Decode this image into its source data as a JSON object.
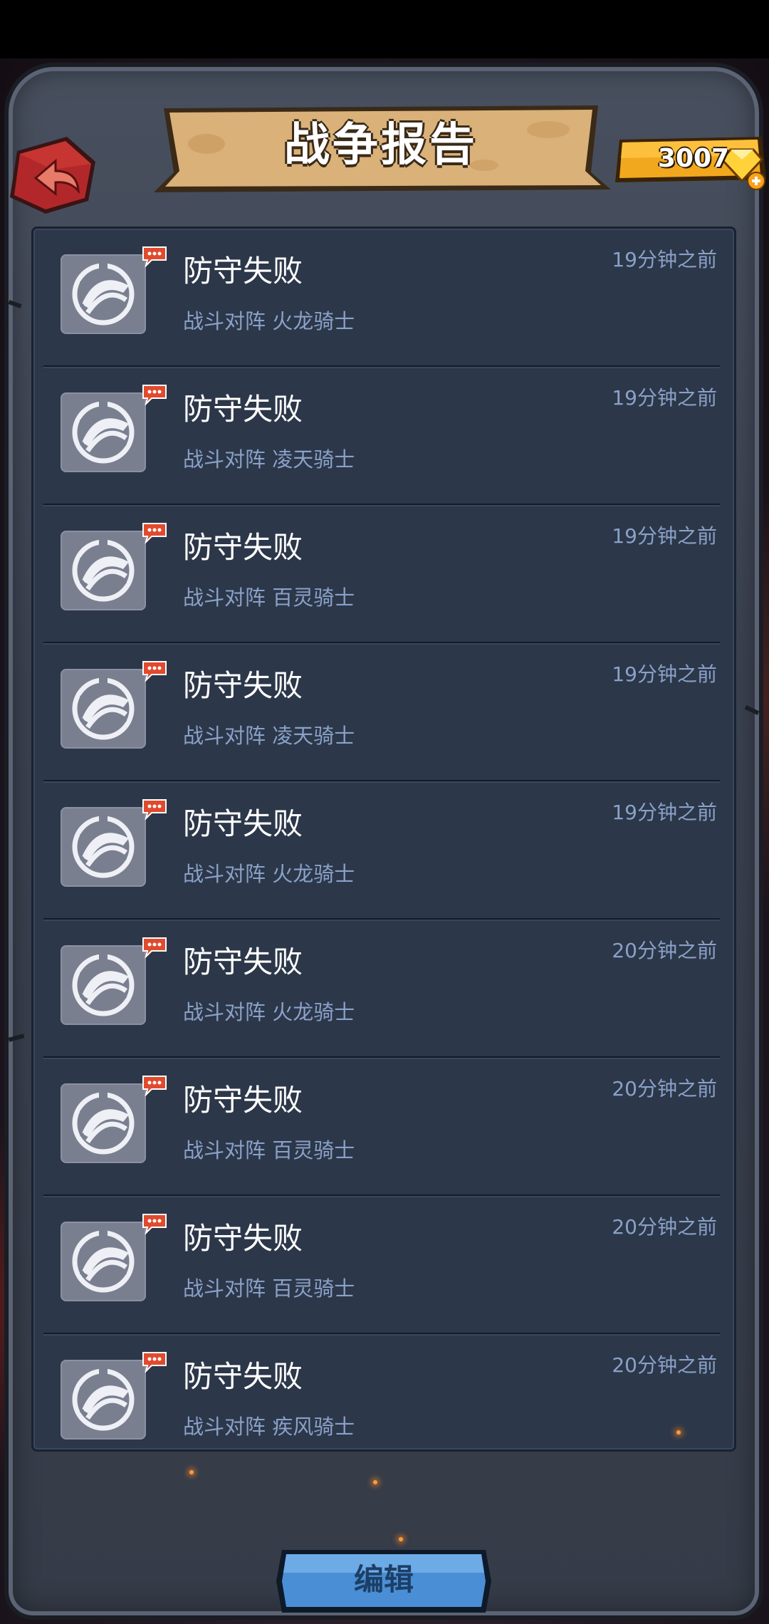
{
  "header": {
    "title": "战争报告",
    "gems": "3007"
  },
  "reports": [
    {
      "title": "防守失败",
      "subtitle": "战斗对阵 火龙骑士",
      "time": "19分钟之前"
    },
    {
      "title": "防守失败",
      "subtitle": "战斗对阵 凌天骑士",
      "time": "19分钟之前"
    },
    {
      "title": "防守失败",
      "subtitle": "战斗对阵 百灵骑士",
      "time": "19分钟之前"
    },
    {
      "title": "防守失败",
      "subtitle": "战斗对阵 凌天骑士",
      "time": "19分钟之前"
    },
    {
      "title": "防守失败",
      "subtitle": "战斗对阵 火龙骑士",
      "time": "19分钟之前"
    },
    {
      "title": "防守失败",
      "subtitle": "战斗对阵 火龙骑士",
      "time": "20分钟之前"
    },
    {
      "title": "防守失败",
      "subtitle": "战斗对阵 百灵骑士",
      "time": "20分钟之前"
    },
    {
      "title": "防守失败",
      "subtitle": "战斗对阵 百灵骑士",
      "time": "20分钟之前"
    },
    {
      "title": "防守失败",
      "subtitle": "战斗对阵 疾风骑士",
      "time": "20分钟之前"
    }
  ],
  "footer": {
    "edit_label": "编辑"
  },
  "icons": {
    "back": "back-arrow-icon",
    "gem": "diamond-gem-icon",
    "add": "plus-icon",
    "report": "shield-report-icon",
    "badge": "unread-message-icon"
  },
  "colors": {
    "panel": "#2c3749",
    "banner": "#d9b179",
    "back_button": "#b2282a",
    "gem_bar": "#f2a81e",
    "edit_button": "#4a8fd6",
    "subtitle_text": "#8aa1c8",
    "badge": "#e04a2e"
  }
}
